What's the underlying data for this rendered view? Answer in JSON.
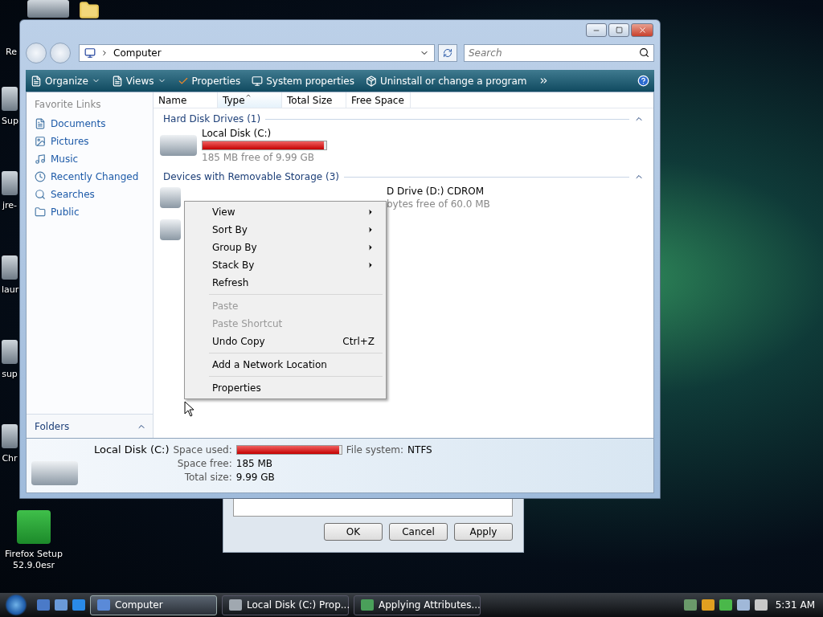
{
  "desktop": {
    "icons": [
      {
        "label": "Re"
      },
      {
        "label": "Sup"
      },
      {
        "label": "jre-"
      },
      {
        "label": "laur"
      },
      {
        "label": "sup"
      },
      {
        "label": "Chr"
      },
      {
        "label": "Firefox Setup 52.9.0esr"
      }
    ]
  },
  "explorer": {
    "address": "Computer",
    "search": {
      "placeholder": "Search"
    },
    "toolbar": [
      {
        "label": "Organize",
        "kind": "menu"
      },
      {
        "label": "Views",
        "kind": "menu"
      },
      {
        "label": "Properties",
        "kind": "check"
      },
      {
        "label": "System properties",
        "kind": "monitor"
      },
      {
        "label": "Uninstall or change a program",
        "kind": "program"
      }
    ],
    "sidebar": {
      "heading": "Favorite Links",
      "items": [
        {
          "label": "Documents"
        },
        {
          "label": "Pictures"
        },
        {
          "label": "Music"
        },
        {
          "label": "Recently Changed"
        },
        {
          "label": "Searches"
        },
        {
          "label": "Public"
        }
      ],
      "folders": "Folders"
    },
    "columns": [
      {
        "label": "Name",
        "sorted": false
      },
      {
        "label": "Type",
        "sorted": true
      },
      {
        "label": "Total Size",
        "sorted": false
      },
      {
        "label": "Free Space",
        "sorted": false
      }
    ],
    "groups": [
      {
        "title": "Hard Disk Drives (1)",
        "expanded": true,
        "items": [
          {
            "kind": "disk",
            "name": "Local Disk (C:)",
            "level": 0.98,
            "detail": "185 MB free of 9.99 GB"
          }
        ]
      },
      {
        "title": "Devices with Removable Storage (3)",
        "expanded": true,
        "items": [
          {
            "kind": "floppy"
          },
          {
            "kind": "cd",
            "name": "D Drive (D:) CDROM",
            "detail": "bytes free of 60.0 MB"
          },
          {
            "kind": "usb"
          }
        ]
      }
    ],
    "details": {
      "name": "Local Disk (C:)",
      "used_label": "Space used:",
      "level": 0.98,
      "fs_label": "File system:",
      "fs": "NTFS",
      "free_label": "Space free:",
      "free": "185 MB",
      "total_label": "Total size:",
      "total": "9.99 GB"
    }
  },
  "context_menu": {
    "groups": [
      [
        {
          "label": "View",
          "submenu": true,
          "disabled": false
        },
        {
          "label": "Sort By",
          "submenu": true,
          "disabled": false
        },
        {
          "label": "Group By",
          "submenu": true,
          "disabled": false
        },
        {
          "label": "Stack By",
          "submenu": true,
          "disabled": false
        },
        {
          "label": "Refresh",
          "submenu": false,
          "disabled": false
        }
      ],
      [
        {
          "label": "Paste",
          "submenu": false,
          "disabled": true
        },
        {
          "label": "Paste Shortcut",
          "submenu": false,
          "disabled": true
        },
        {
          "label": "Undo Copy",
          "shortcut": "Ctrl+Z",
          "submenu": false,
          "disabled": false
        }
      ],
      [
        {
          "label": "Add a Network Location",
          "submenu": false,
          "disabled": false
        }
      ],
      [
        {
          "label": "Properties",
          "submenu": false,
          "disabled": false
        }
      ]
    ]
  },
  "dialog": {
    "buttons": [
      "OK",
      "Cancel",
      "Apply"
    ]
  },
  "taskbar": {
    "tasks": [
      {
        "label": "Computer",
        "selected": true
      },
      {
        "label": "Local Disk (C:) Prop...",
        "selected": false
      },
      {
        "label": "Applying Attributes...",
        "selected": false
      }
    ],
    "time": "5:31 AM"
  }
}
